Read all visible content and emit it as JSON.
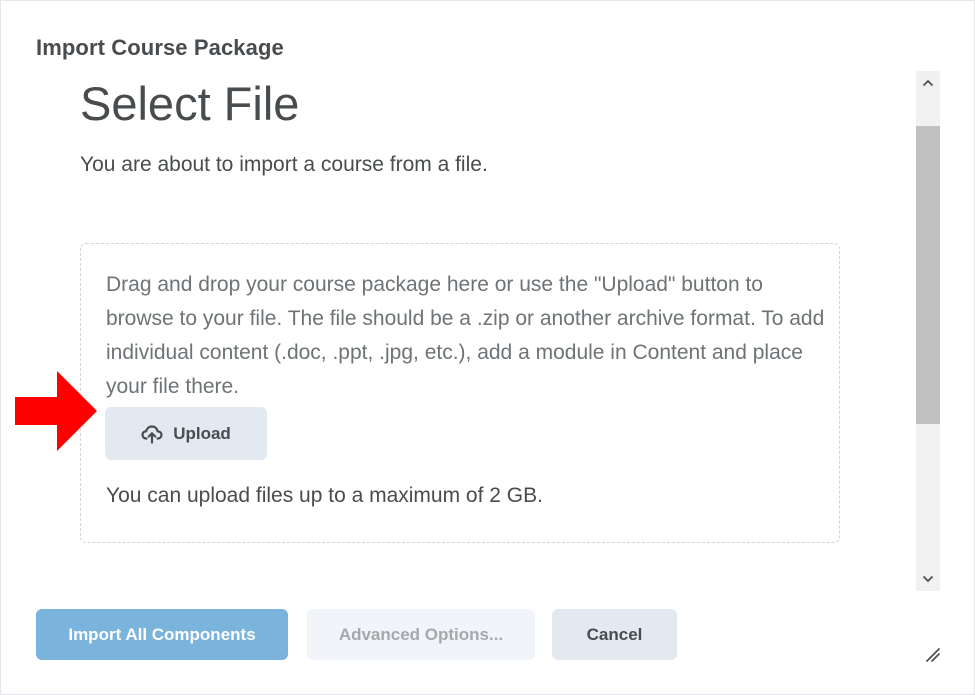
{
  "dialog": {
    "title": "Import Course Package"
  },
  "content": {
    "heading": "Select File",
    "intro": "You are about to import a course from a file.",
    "dropzone": {
      "instructions": "Drag and drop your course package here or use the \"Upload\" button to browse to your file. The file should be a .zip or another archive format. To add individual content (.doc, .ppt, .jpg, etc.), add a module in Content and place your file there.",
      "upload_label": "Upload",
      "upload_icon": "cloud-upload-icon",
      "max_size_text": "You can upload files up to a maximum of 2 GB."
    }
  },
  "footer": {
    "import_all_label": "Import All Components",
    "advanced_label": "Advanced Options...",
    "cancel_label": "Cancel"
  },
  "annotation": {
    "arrow_icon": "red-arrow-icon",
    "arrow_color": "#ff0000"
  },
  "colors": {
    "primary_button": "#7ab3db",
    "secondary_button": "#e3e9f1",
    "disabled_button": "#f1f5fa",
    "text": "#494c4e"
  }
}
